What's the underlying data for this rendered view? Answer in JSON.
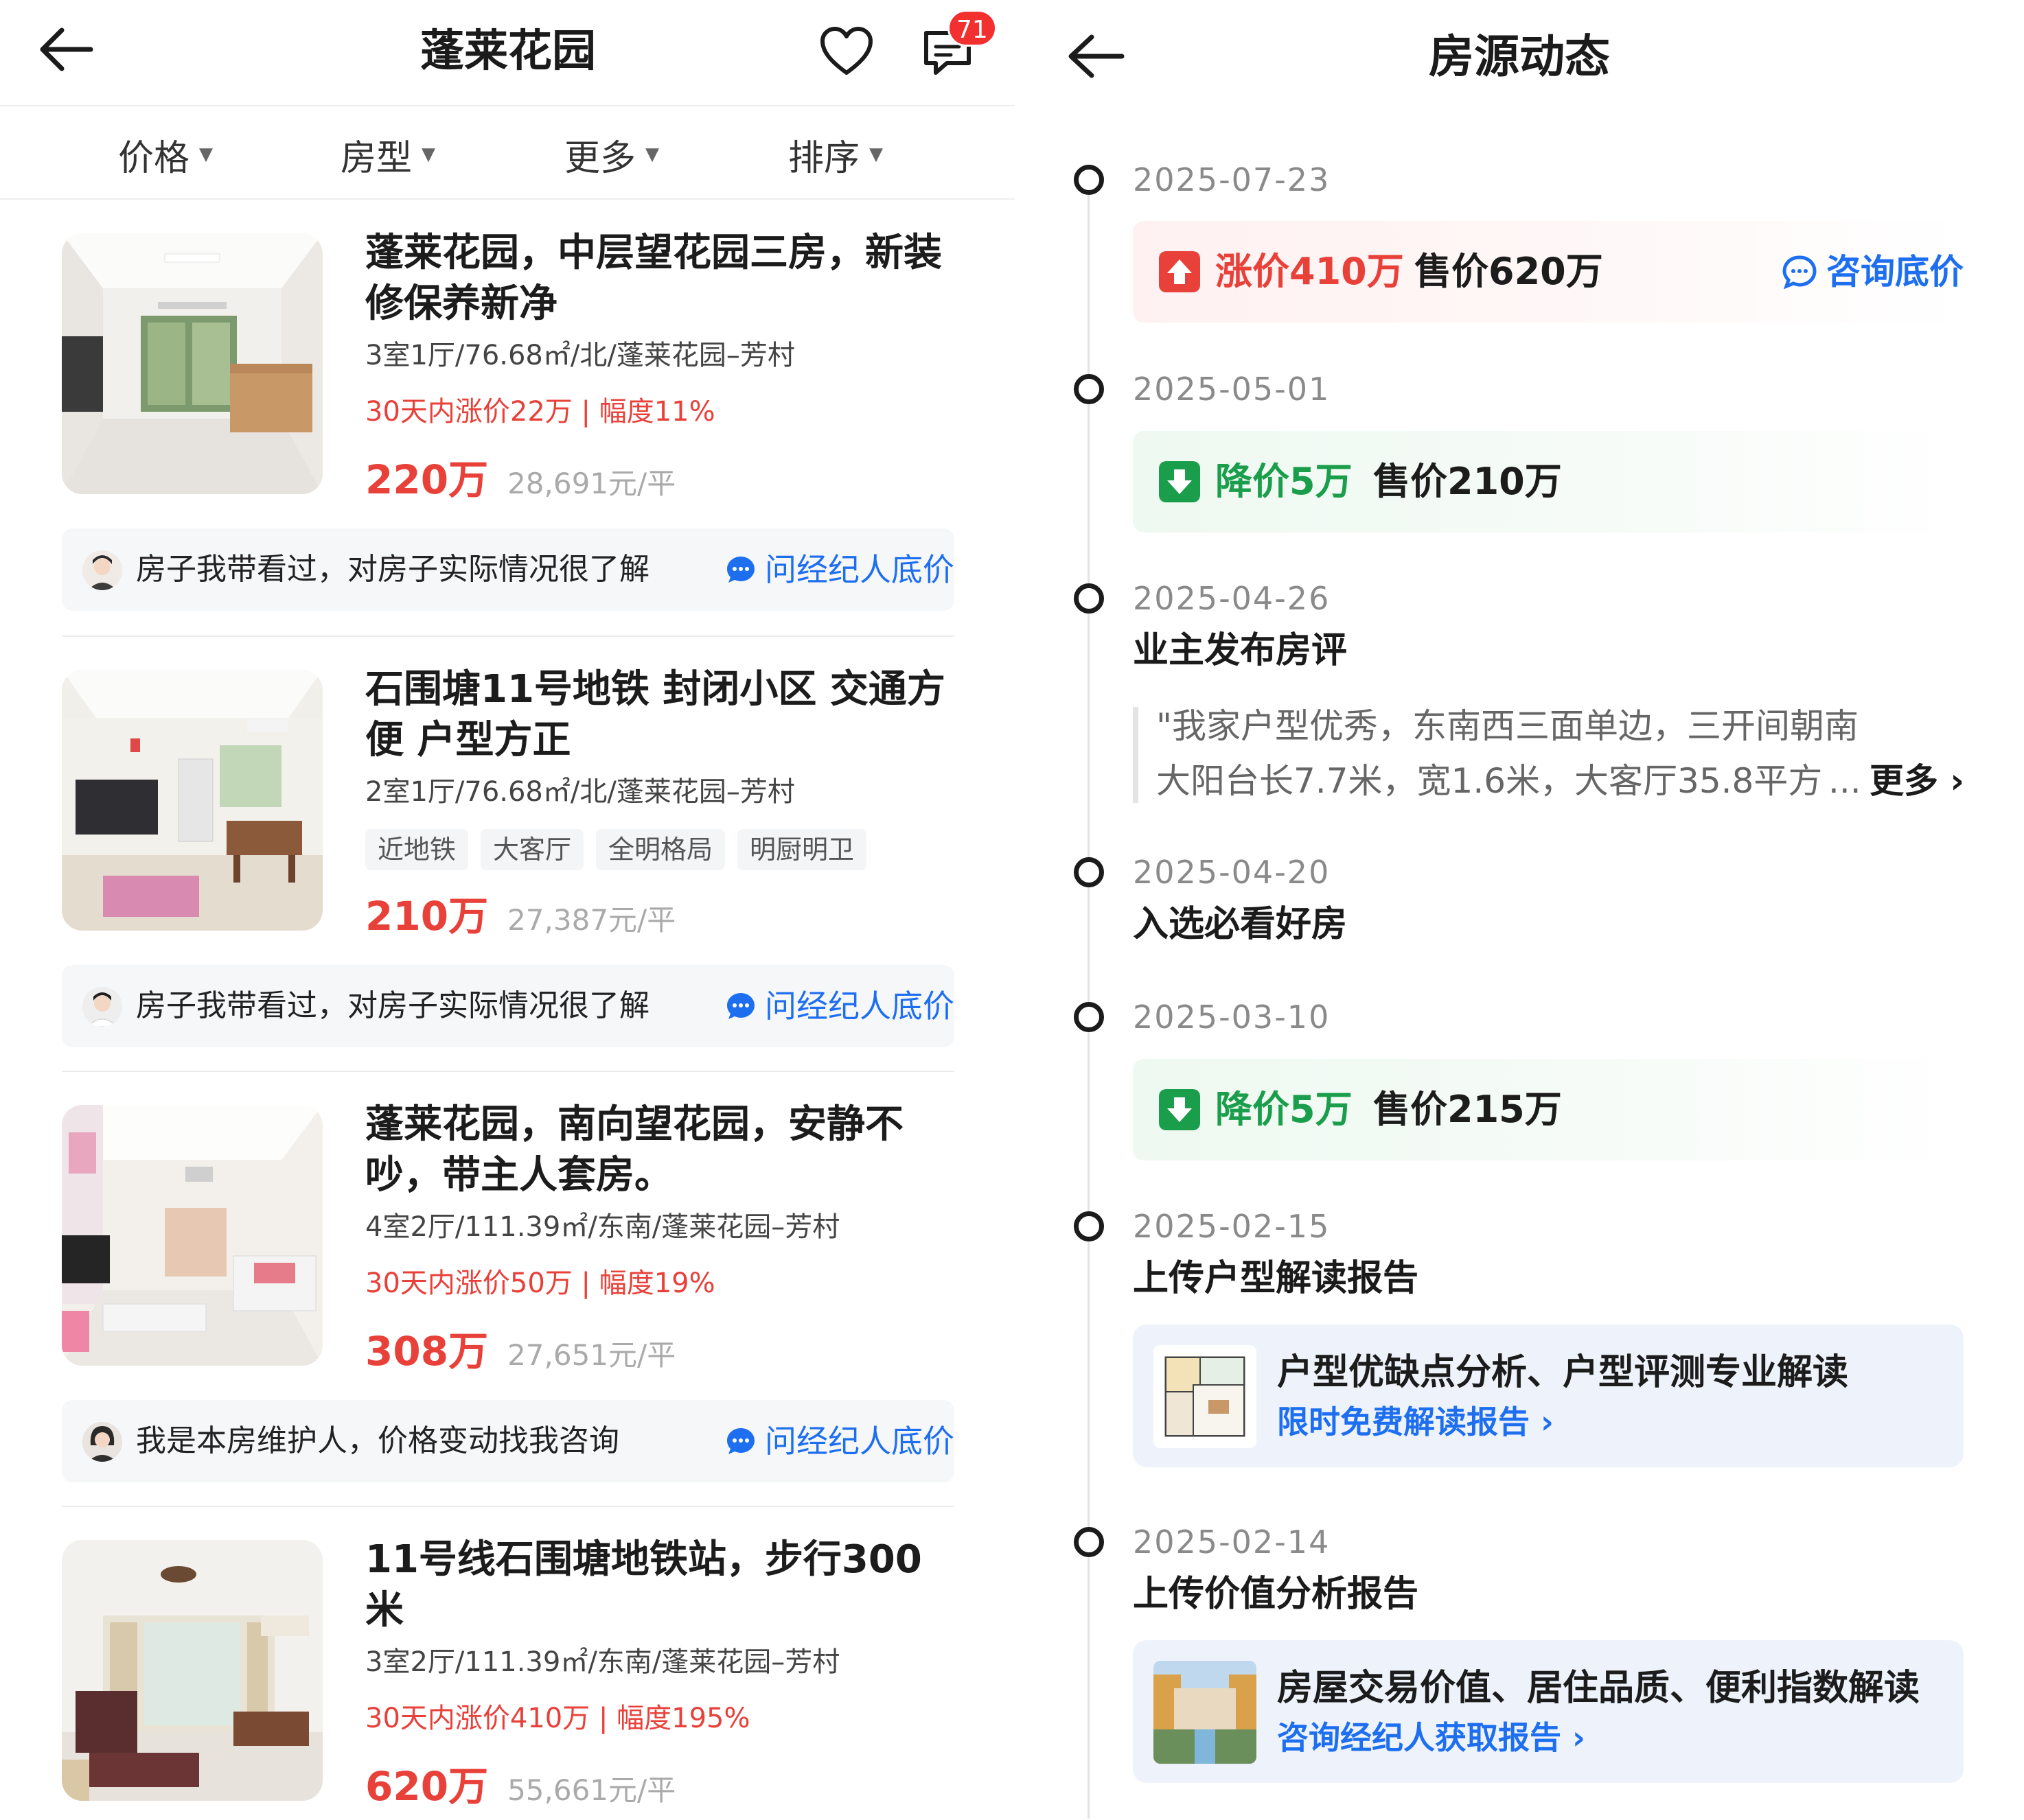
{
  "listing_page": {
    "title": "蓬莱花园",
    "message_badge": "71",
    "filters": [
      "价格",
      "房型",
      "更多",
      "排序"
    ],
    "ask_agent_label": "问经纪人底价",
    "listings": [
      {
        "title": "蓬莱花园，中层望花园三房，新装修保养新净",
        "meta": "3室1厅/76.68㎡/北/蓬莱花园–芳村",
        "change": "30天内涨价22万 | 幅度11%",
        "price": "220万",
        "unit_price": "28,691元/平",
        "agent_note": "房子我带看过，对房子实际情况很了解"
      },
      {
        "title": "石围塘11号地铁  封闭小区  交通方便 户型方正",
        "meta": "2室1厅/76.68㎡/北/蓬莱花园–芳村",
        "tags": [
          "近地铁",
          "大客厅",
          "全明格局",
          "明厨明卫"
        ],
        "price": "210万",
        "unit_price": "27,387元/平",
        "agent_note": "房子我带看过，对房子实际情况很了解"
      },
      {
        "title": "蓬莱花园，南向望花园，安静不吵，带主人套房。",
        "meta": "4室2厅/111.39㎡/东南/蓬莱花园–芳村",
        "change": "30天内涨价50万 | 幅度19%",
        "price": "308万",
        "unit_price": "27,651元/平",
        "agent_note": "我是本房维护人，价格变动找我咨询"
      },
      {
        "title": "11号线石围塘地铁站，步行300米",
        "meta": "3室2厅/111.39㎡/东南/蓬莱花园–芳村",
        "change": "30天内涨价410万 | 幅度195%",
        "price": "620万",
        "unit_price": "55,661元/平"
      }
    ]
  },
  "timeline_page": {
    "title": "房源动态",
    "events": [
      {
        "date": "2025-07-23",
        "change": "涨价410万",
        "sale": "售价620万",
        "consult": "咨询底价",
        "direction": "up"
      },
      {
        "date": "2025-05-01",
        "change": "降价5万",
        "sale": "售价210万",
        "direction": "down"
      },
      {
        "date": "2025-04-26",
        "event": "业主发布房评",
        "quote_line1": "\"我家户型优秀，东南西三面单边，三开间朝南，",
        "quote_line2": "大阳台长7.7米，宽1.6米，大客厅35.8平方",
        "quote_ellipsis": "...",
        "more": "更多"
      },
      {
        "date": "2025-04-20",
        "event": "入选必看好房"
      },
      {
        "date": "2025-03-10",
        "change": "降价5万",
        "sale": "售价215万",
        "direction": "down"
      },
      {
        "date": "2025-02-15",
        "event": "上传户型解读报告",
        "report_title": "户型优缺点分析、户型评测专业解读",
        "report_link": "限时免费解读报告"
      },
      {
        "date": "2025-02-14",
        "event": "上传价值分析报告",
        "report_title": "房屋交易价值、居住品质、便利指数解读",
        "report_link": "咨询经纪人获取报告"
      }
    ]
  },
  "colors": {
    "accent_red": "#e8413a",
    "accent_green": "#1a9e4b",
    "accent_blue": "#1e6ff0",
    "badge_red": "#f23030"
  },
  "icons": [
    "back-arrow-icon",
    "heart-icon",
    "message-icon",
    "chat-bubble-icon",
    "arrow-up-icon",
    "arrow-down-icon",
    "chevron-right-icon",
    "chevron-down-icon"
  ]
}
